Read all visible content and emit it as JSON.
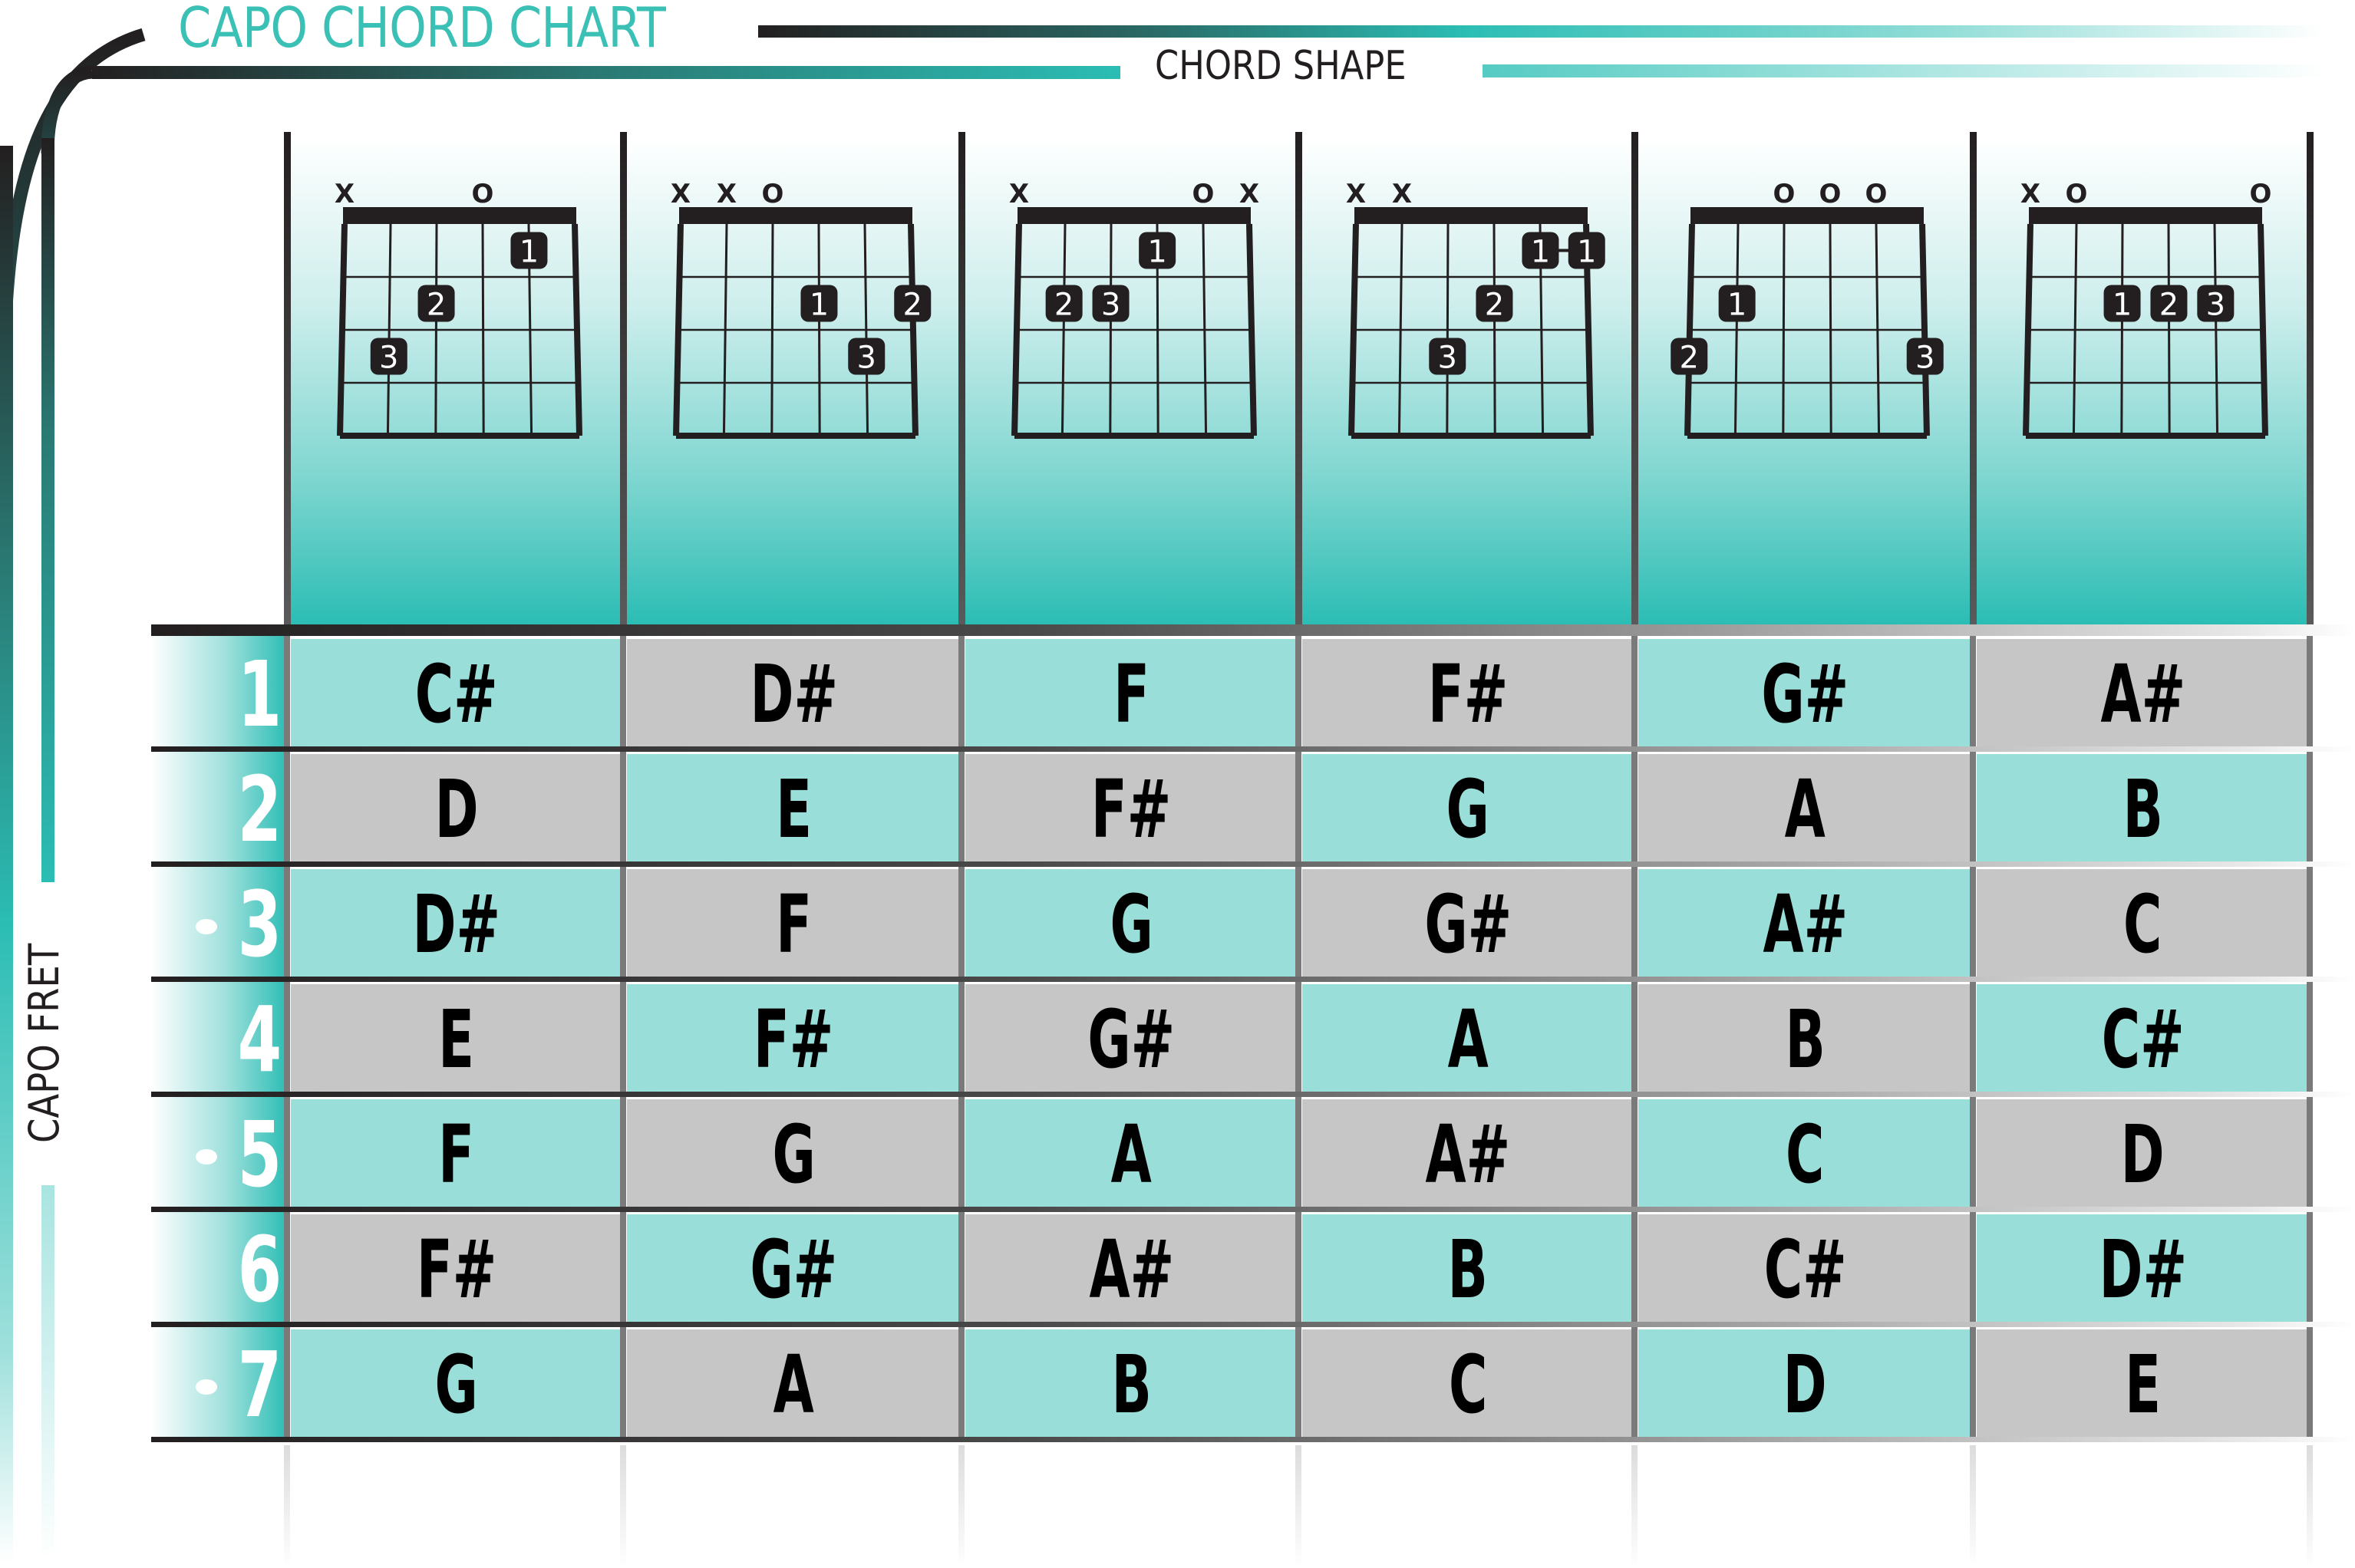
{
  "header": {
    "title": "CAPO CHORD CHART",
    "chord_shape_label": "CHORD SHAPE",
    "capo_fret_label": "CAPO FRET"
  },
  "colors": {
    "accent": "#2BBDB4",
    "title": "#3BC0B6",
    "teal_cell": "#99DED9",
    "gray_cell": "#C6C6C6",
    "ink": "#231F20"
  },
  "chord_shapes": [
    {
      "name": "C",
      "markers": [
        "X",
        "",
        "",
        "O",
        "",
        ""
      ],
      "fingers": [
        {
          "finger": "3",
          "string": 1,
          "fret": 3
        },
        {
          "finger": "2",
          "string": 2,
          "fret": 2
        },
        {
          "finger": "1",
          "string": 4,
          "fret": 1
        }
      ]
    },
    {
      "name": "D",
      "markers": [
        "X",
        "X",
        "O",
        "",
        "",
        ""
      ],
      "fingers": [
        {
          "finger": "1",
          "string": 3,
          "fret": 2
        },
        {
          "finger": "3",
          "string": 4,
          "fret": 3
        },
        {
          "finger": "2",
          "string": 5,
          "fret": 2
        }
      ]
    },
    {
      "name": "E",
      "markers": [
        "X",
        "",
        "",
        "",
        "O",
        "X"
      ],
      "fingers": [
        {
          "finger": "2",
          "string": 1,
          "fret": 2
        },
        {
          "finger": "3",
          "string": 2,
          "fret": 2
        },
        {
          "finger": "1",
          "string": 3,
          "fret": 1
        }
      ]
    },
    {
      "name": "F",
      "markers": [
        "X",
        "X",
        "",
        "",
        "",
        ""
      ],
      "fingers": [
        {
          "finger": "3",
          "string": 2,
          "fret": 3
        },
        {
          "finger": "2",
          "string": 3,
          "fret": 2
        },
        {
          "finger": "1",
          "string": 4,
          "fret": 1
        },
        {
          "finger": "1",
          "string": 5,
          "fret": 1
        }
      ],
      "barre": {
        "from": 4,
        "to": 5,
        "fret": 1
      }
    },
    {
      "name": "G",
      "markers": [
        "",
        "",
        "O",
        "O",
        "O",
        ""
      ],
      "fingers": [
        {
          "finger": "2",
          "string": 0,
          "fret": 3
        },
        {
          "finger": "1",
          "string": 1,
          "fret": 2
        },
        {
          "finger": "3",
          "string": 5,
          "fret": 3
        }
      ]
    },
    {
      "name": "A",
      "markers": [
        "X",
        "O",
        "",
        "",
        "",
        "O"
      ],
      "fingers": [
        {
          "finger": "1",
          "string": 2,
          "fret": 2
        },
        {
          "finger": "2",
          "string": 3,
          "fret": 2
        },
        {
          "finger": "3",
          "string": 4,
          "fret": 2
        }
      ]
    }
  ],
  "rows": [
    {
      "fret": "1",
      "dot": false,
      "chords": [
        "C#",
        "D#",
        "F",
        "F#",
        "G#",
        "A#"
      ]
    },
    {
      "fret": "2",
      "dot": false,
      "chords": [
        "D",
        "E",
        "F#",
        "G",
        "A",
        "B"
      ]
    },
    {
      "fret": "3",
      "dot": true,
      "chords": [
        "D#",
        "F",
        "G",
        "G#",
        "A#",
        "C"
      ]
    },
    {
      "fret": "4",
      "dot": false,
      "chords": [
        "E",
        "F#",
        "G#",
        "A",
        "B",
        "C#"
      ]
    },
    {
      "fret": "5",
      "dot": true,
      "chords": [
        "F",
        "G",
        "A",
        "A#",
        "C",
        "D"
      ]
    },
    {
      "fret": "6",
      "dot": false,
      "chords": [
        "F#",
        "G#",
        "A#",
        "B",
        "C#",
        "D#"
      ]
    },
    {
      "fret": "7",
      "dot": true,
      "chords": [
        "G",
        "A",
        "B",
        "C",
        "D",
        "E"
      ]
    }
  ]
}
